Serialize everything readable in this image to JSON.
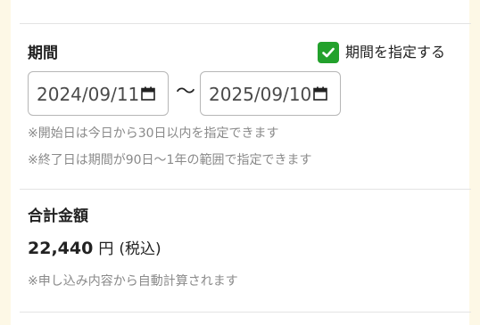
{
  "period": {
    "title": "期間",
    "checkbox_label": "期間を指定する",
    "checkbox_checked": true,
    "start_date": "2024/09/11",
    "separator": "〜",
    "end_date": "2025/09/10",
    "notes": [
      "※開始日は今日から30日以内を指定できます",
      "※終了日は期間が90日〜1年の範囲で指定できます"
    ]
  },
  "total": {
    "title": "合計金額",
    "amount": "22,440",
    "unit": "円",
    "tax_note": "(税込)",
    "note": "※申し込み内容から自動計算されます"
  },
  "colors": {
    "page_background": "#fdf8e6",
    "panel_background": "#ffffff",
    "checkbox_accent": "#23a12c",
    "note_text": "#8a8a8a",
    "divider": "#e4e4e4"
  },
  "icons": {
    "checkbox": "check-icon",
    "date_picker": "calendar-icon"
  }
}
